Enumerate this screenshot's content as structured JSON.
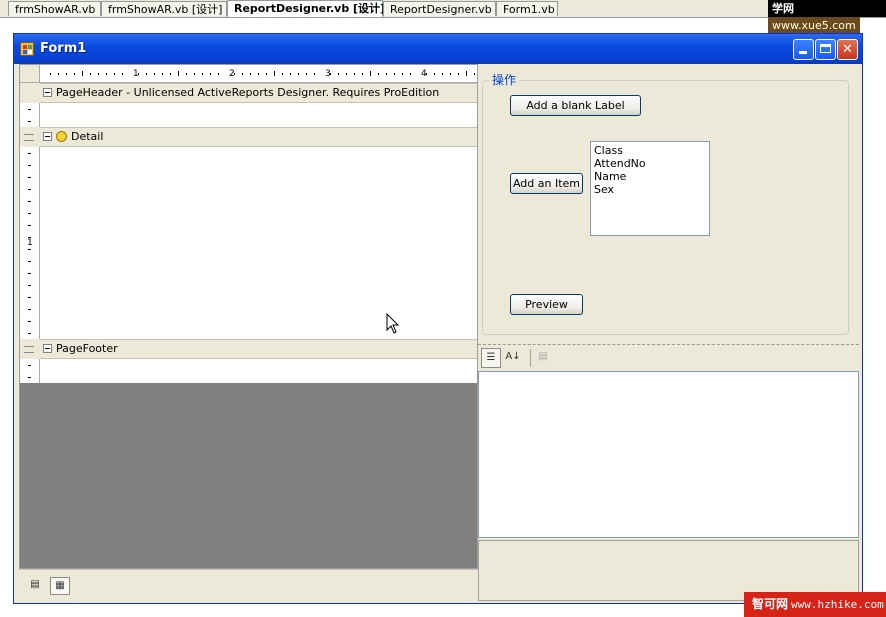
{
  "ide_tabs": [
    {
      "label": "frmShowAR.vb",
      "active": false
    },
    {
      "label": "frmShowAR.vb [设计]",
      "active": false
    },
    {
      "label": "ReportDesigner.vb [设计]",
      "active": true
    },
    {
      "label": "ReportDesigner.vb",
      "active": false
    },
    {
      "label": "Form1.vb",
      "active": false
    }
  ],
  "watermark_top": {
    "brand": "学网",
    "url": "www.xue5.com"
  },
  "window": {
    "title": "Form1",
    "minimize": "_",
    "maximize": "□",
    "close": "✕"
  },
  "designer": {
    "ruler_numbers": [
      "1",
      "2",
      "3",
      "4"
    ],
    "vruler_number": "1",
    "bands": {
      "page_header": "PageHeader  -  Unlicensed ActiveReports Designer. Requires ProEdition",
      "detail": "Detail",
      "page_footer": "PageFooter"
    }
  },
  "group": {
    "title": "操作",
    "add_label_button": "Add a blank Label",
    "add_item_button": "Add an Item",
    "preview_button": "Preview",
    "list_items": [
      "Class",
      "AttendNo",
      "Name",
      "Sex"
    ]
  },
  "property_grid": {
    "categorized_icon": "categorized-icon",
    "alphabetical_icon": "alphabetical-icon",
    "property_pages_icon": "property-pages-icon"
  },
  "watermark_bottom": {
    "brand": "智可网",
    "url": "www.hzhike.com"
  },
  "colors": {
    "titlebar": "#0a4ae0",
    "face": "#ece9d8",
    "group_title": "#0046d5"
  }
}
